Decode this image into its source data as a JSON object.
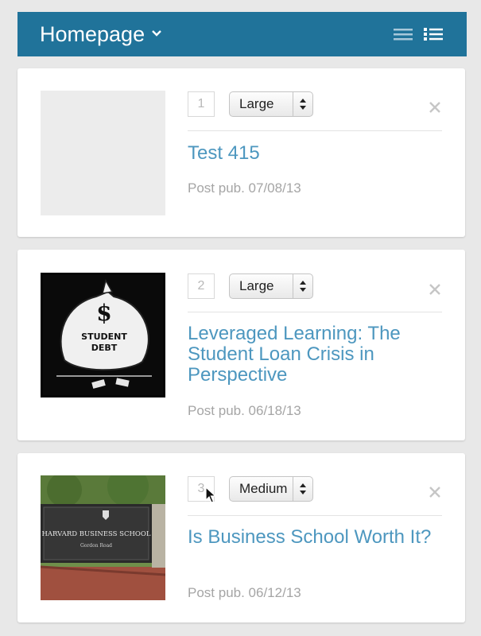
{
  "header": {
    "title": "Homepage",
    "bg_color": "#20739a",
    "icons": [
      "chevron-down-icon",
      "list-view-icon",
      "detail-list-view-icon"
    ]
  },
  "cards": [
    {
      "order": "1",
      "size": "Large",
      "headline": "Test 415",
      "date": "Post pub. 07/08/13",
      "thumbnail": "empty"
    },
    {
      "order": "2",
      "size": "Large",
      "headline": "Leveraged Learning: The Student Loan Crisis in Perspective",
      "date": "Post pub. 06/18/13",
      "thumbnail": "cartoon-student-debt",
      "thumb_text": [
        "STUDENT",
        "DEBT"
      ]
    },
    {
      "order": "3",
      "size": "Medium",
      "headline": "Is Business School Worth It?",
      "date": "Post pub. 06/12/13",
      "thumbnail": "photo-harvard-business-school-sign",
      "thumb_text": [
        "HARVARD BUSINESS SCHOOL",
        "Gordon Road"
      ]
    }
  ],
  "colors": {
    "link": "#4d97bf",
    "meta": "#a5a5a5",
    "page_bg": "#e8e8e8"
  }
}
